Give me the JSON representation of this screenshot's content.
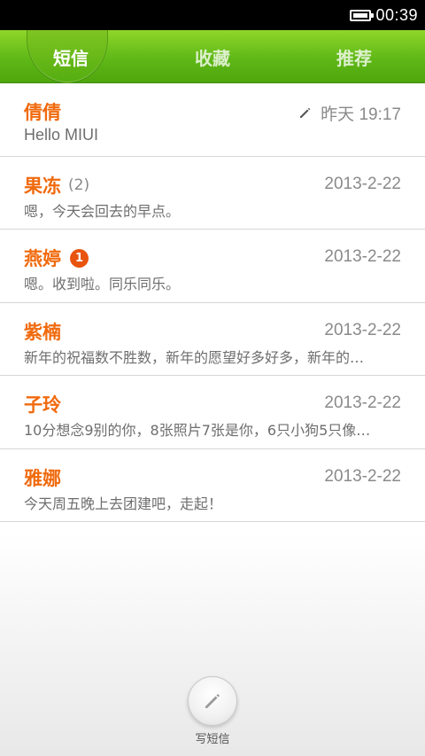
{
  "status_bar": {
    "time": "00:39",
    "battery_icon": "battery-full-icon"
  },
  "tabs": [
    {
      "label": "短信",
      "active": true
    },
    {
      "label": "收藏",
      "active": false
    },
    {
      "label": "推荐",
      "active": false
    }
  ],
  "conversations": [
    {
      "name": "倩倩",
      "count": "",
      "badge": "",
      "date": "昨天 19:17",
      "draft_icon": "pencil-icon",
      "preview": "Hello MIUI"
    },
    {
      "name": "果冻",
      "count": "(2)",
      "badge": "",
      "date": "2013-2-22",
      "preview": "嗯，今天会回去的早点。"
    },
    {
      "name": "燕婷",
      "count": "",
      "badge": "1",
      "date": "2013-2-22",
      "preview": "嗯。收到啦。同乐同乐。"
    },
    {
      "name": "紫楠",
      "count": "",
      "badge": "",
      "date": "2013-2-22",
      "preview": "新年的祝福数不胜数，新年的愿望好多好多，新年的…"
    },
    {
      "name": "子玲",
      "count": "",
      "badge": "",
      "date": "2013-2-22",
      "preview": "10分想念9别的你，8张照片7张是你，6只小狗5只像…"
    },
    {
      "name": "雅娜",
      "count": "",
      "badge": "",
      "date": "2013-2-22",
      "preview": "今天周五晚上去团建吧，走起！"
    }
  ],
  "compose": {
    "label": "写短信",
    "icon": "pencil-icon"
  },
  "colors": {
    "accent_green": "#5fb817",
    "name_orange": "#f06a0e",
    "badge_orange": "#e8540c"
  }
}
